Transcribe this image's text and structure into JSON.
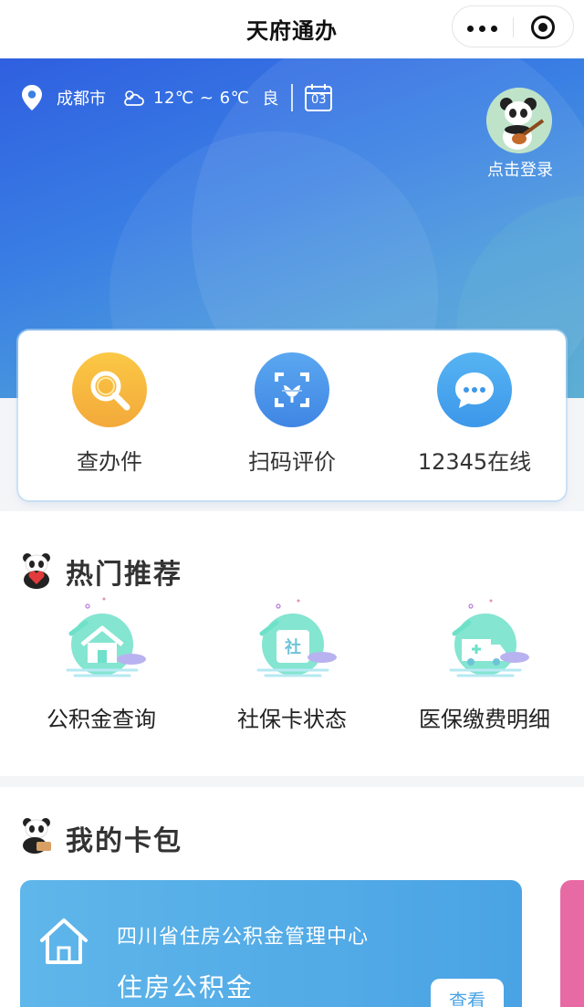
{
  "navbar": {
    "title": "天府通办"
  },
  "hero": {
    "city": "成都市",
    "temperature": "12℃ ~ 6℃",
    "air_quality": "良",
    "calendar_day": "03",
    "login_label": "点击登录"
  },
  "quick_actions": [
    {
      "label": "查办件",
      "icon": "search-icon",
      "color": "#f5b53a"
    },
    {
      "label": "扫码评价",
      "icon": "scan-icon",
      "color": "#4d97ec"
    },
    {
      "label": "12345在线",
      "icon": "chat-bubble-icon",
      "color": "#4aa8ee"
    }
  ],
  "hot_section": {
    "title": "热门推荐",
    "items": [
      {
        "label": "公积金查询",
        "icon": "house-icon"
      },
      {
        "label": "社保卡状态",
        "icon": "social-security-card-icon",
        "badge_text": "社"
      },
      {
        "label": "医保缴费明细",
        "icon": "ambulance-icon"
      }
    ]
  },
  "wallet_section": {
    "title": "我的卡包",
    "card": {
      "org": "四川省住房公积金管理中心",
      "name": "住房公积金",
      "action": "查看"
    }
  },
  "colors": {
    "hero_start": "#2f5fe0",
    "hero_end": "#5aaad6",
    "card_blue": "#4aa3e4",
    "card_pink": "#e86aa4",
    "mint": "#6fe0c9"
  }
}
